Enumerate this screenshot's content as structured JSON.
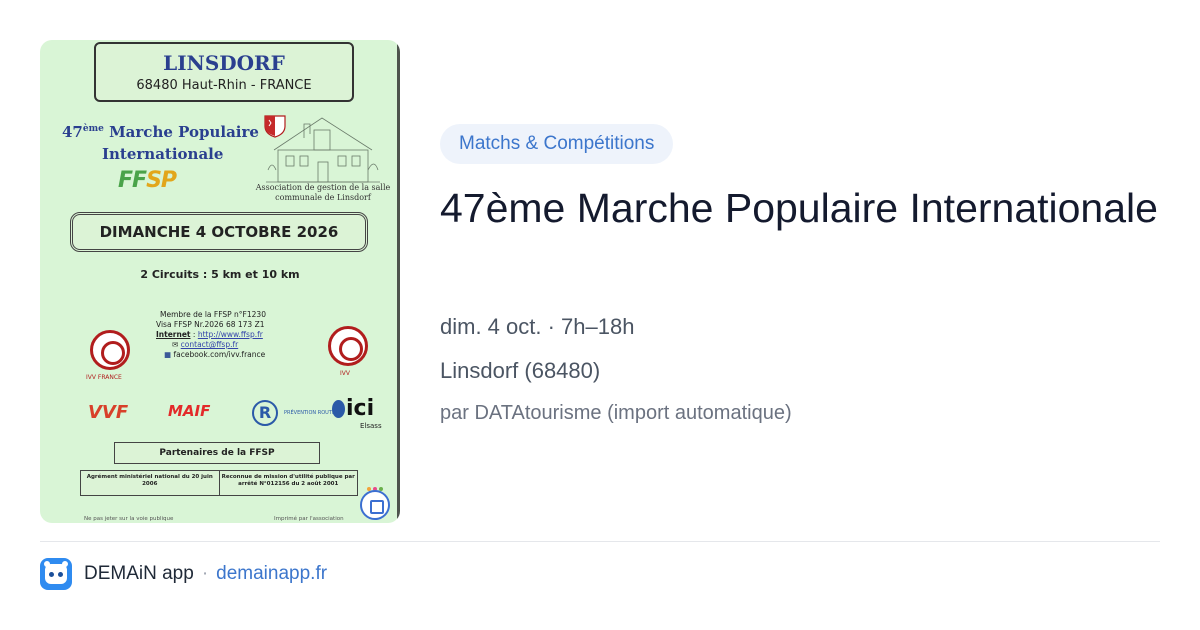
{
  "poster": {
    "town": "LINSDORF",
    "dept": "68480 Haut-Rhin - FRANCE",
    "march_line1": "47ème Marche Populaire",
    "march_sup": "ème",
    "march_num": "47",
    "march_rest": " Marche Populaire",
    "march_line2": "Internationale",
    "ffsp_logo_a": "FF",
    "ffsp_logo_b": "SP",
    "association": "Association de gestion de la salle communale de Linsdorf",
    "date_banner": "DIMANCHE 4 OCTOBRE 2026",
    "circuits": "2 Circuits : 5 km et 10 km",
    "members_line1": "Membre de la FFSP n°F1230",
    "members_line2": "Visa FFSP Nr.2026 68 173 Z1",
    "internet_label": "Internet",
    "internet_url": "http://www.ffsp.fr",
    "contact_email": "contact@ffsp.fr",
    "facebook": "facebook.com/ivv.france",
    "badge_caption_left": "IVV FRANCE",
    "badge_caption_right": "IVV",
    "sponsors": {
      "vvf": "VVF",
      "maif": "MAIF",
      "r_letter": "R",
      "r_text": "PRÉVENTION ROUTIÈRE",
      "ici": "ici",
      "ici_sub": "Elsass"
    },
    "partners": "Partenaires de la FFSP",
    "agreement_left": "Agrément ministériel national du 20 juin 2006",
    "agreement_right": "Reconnue de mission d'utilité publique par arrêté N°012156 du 2 août 2001",
    "footer_left": "Ne pas jeter sur la voie publique",
    "footer_right": "Imprimé par l'association"
  },
  "event": {
    "category": "Matchs & Compétitions",
    "title": "47ème Marche Populaire Internationale",
    "datetime": "dim. 4 oct. · 7h–18h",
    "location": "Linsdorf (68480)",
    "source": "par DATAtourisme (import automatique)"
  },
  "footer": {
    "app_name": "DEMAiN app",
    "separator": "·",
    "domain": "demainapp.fr"
  },
  "colors": {
    "accent": "#3c76cc",
    "poster_bg": "#d9f5d6",
    "app_icon": "#2f8bf0"
  },
  "icons": {
    "app": "demain-app-icon",
    "poster_corner": "calendar-icon"
  }
}
